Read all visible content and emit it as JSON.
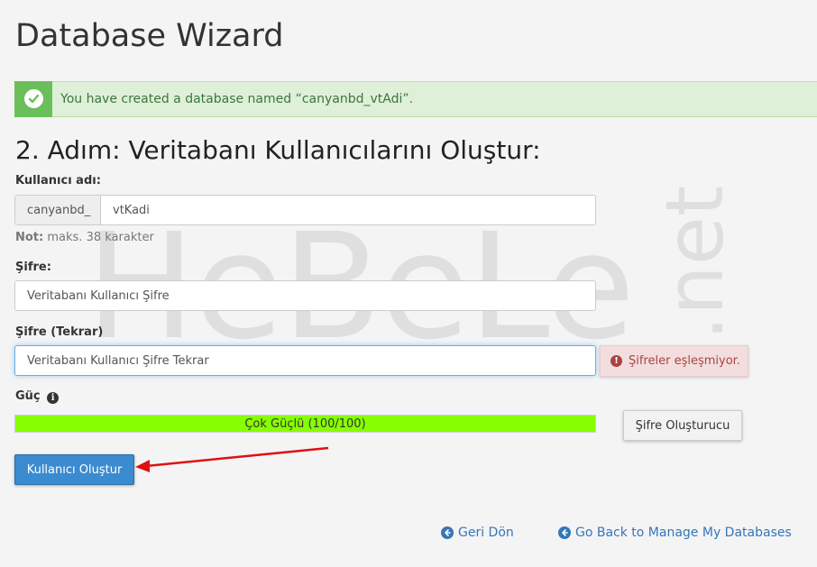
{
  "page": {
    "title": "Database Wizard"
  },
  "alert": {
    "message": "You have created a database named “canyanbd_vtAdi”.",
    "icon": "check-circle-icon"
  },
  "step": {
    "title": "2. Adım: Veritabanı Kullanıcılarını Oluştur:"
  },
  "form": {
    "username_label": "Kullanıcı adı:",
    "username_prefix": "canyanbd_",
    "username_value": "vtKadi",
    "note_label": "Not:",
    "note_text": " maks. 38 karakter",
    "password_label": "Şifre:",
    "password_value": "Veritabanı Kullanıcı Şifre",
    "password_repeat_label": "Şifre (Tekrar)",
    "password_repeat_value": "Veritabanı Kullanıcı Şifre Tekrar",
    "mismatch_error": "Şifreler eşleşmiyor.",
    "strength_label": "Güç",
    "strength_text": "Çok Güçlü (100/100)",
    "strength_fraction": 1.0,
    "generator_button": "Şifre Oluşturucu",
    "submit_button": "Kullanıcı Oluştur"
  },
  "links": {
    "back": "Geri Dön",
    "manage": "Go Back to Manage My Databases"
  },
  "watermark": {
    "main": "HeBeLe",
    "suffix": ".net"
  },
  "colors": {
    "success_bg": "#dff0d8",
    "success_icon": "#6bbf5a",
    "error_bg": "#f2dede",
    "error_text": "#a94442",
    "strength_fill": "#88ff00",
    "primary": "#3b8bd0",
    "link": "#3576b8",
    "annotation_arrow": "#e01010"
  }
}
